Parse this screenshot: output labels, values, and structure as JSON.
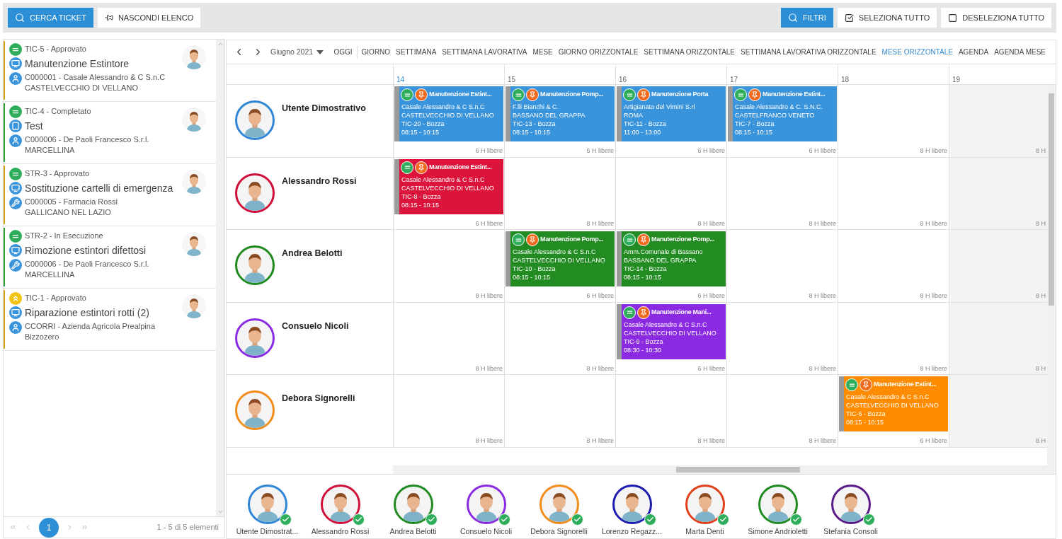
{
  "toolbar": {
    "left_buttons": [
      {
        "label": "CERCA TICKET",
        "kind": "primary"
      },
      {
        "label": "NASCONDI ELENCO",
        "kind": "pin"
      }
    ],
    "right_buttons": [
      {
        "label": "FILTRI",
        "kind": "primary"
      },
      {
        "label": "SELEZIONA TUTTO",
        "kind": "checked"
      },
      {
        "label": "DESELEZIONA TUTTO",
        "kind": "unchecked"
      }
    ]
  },
  "tickets": [
    {
      "status": {
        "kind": "normal",
        "text": "TIC-5 - Approvato"
      },
      "subject": {
        "kind": "monitor",
        "text": "Manutenzione Estintore"
      },
      "customer": {
        "kind": "person",
        "text": "C000001 - Casale Alessandro & C S.n.C",
        "city": "CASTELVECCHIO DI VELLANO"
      },
      "color": "#d4a017"
    },
    {
      "status": {
        "kind": "normal",
        "text": "TIC-4 - Completato"
      },
      "subject": {
        "kind": "tablet",
        "text": "Test"
      },
      "customer": {
        "kind": "person",
        "text": "C000006 - De Paoli Francesco S.r.l.",
        "city": "MARCELLINA"
      },
      "color": "#2e9e2e"
    },
    {
      "status": {
        "kind": "normal",
        "text": "STR-3 - Approvato"
      },
      "subject": {
        "kind": "monitor",
        "text": "Sostituzione cartelli di emergenza"
      },
      "customer": {
        "kind": "wrench",
        "text": "C000005 - Farmacia Rossi",
        "city": "GALLICANO NEL LAZIO"
      },
      "color": "#d4a017"
    },
    {
      "status": {
        "kind": "normal",
        "text": "STR-2 - In Esecuzione"
      },
      "subject": {
        "kind": "monitor",
        "text": "Rimozione estintori difettosi"
      },
      "customer": {
        "kind": "wrench",
        "text": "C000006 - De Paoli Francesco S.r.l.",
        "city": "MARCELLINA"
      },
      "color": "#2e9e2e"
    },
    {
      "status": {
        "kind": "high",
        "text": "TIC-1 - Approvato"
      },
      "subject": {
        "kind": "monitor",
        "text": "Riparazione estintori rotti (2)"
      },
      "customer": {
        "kind": "person",
        "text": "CCORRI - Azienda Agricola Prealpina",
        "city": "Bizzozero"
      },
      "color": "#d4a017"
    }
  ],
  "pager": {
    "pages": [
      {
        "label": "1",
        "selected": true
      }
    ],
    "summary": "1 - 5 di 5 elementi"
  },
  "scheduler": {
    "period": "Giugno 2021",
    "views": [
      {
        "label": "OGGI",
        "selected": false
      },
      {
        "label": "GIORNO",
        "selected": false
      },
      {
        "label": "SETTIMANA",
        "selected": false
      },
      {
        "label": "SETTIMANA LAVORATIVA",
        "selected": false
      },
      {
        "label": "MESE",
        "selected": false
      },
      {
        "label": "GIORNO ORIZZONTALE",
        "selected": false
      },
      {
        "label": "SETTIMANA ORIZZONTALE",
        "selected": false
      },
      {
        "label": "SETTIMANA LAVORATIVA ORIZZONTALE",
        "selected": false
      },
      {
        "label": "MESE ORIZZONTALE",
        "selected": true
      },
      {
        "label": "AGENDA",
        "selected": false
      },
      {
        "label": "AGENDA MESE",
        "selected": false
      }
    ],
    "days": [
      {
        "label": "14",
        "today": true
      },
      {
        "label": "15",
        "today": false
      },
      {
        "label": "16",
        "today": false
      },
      {
        "label": "17",
        "today": false
      },
      {
        "label": "18",
        "today": false
      },
      {
        "label": "19",
        "today": false
      }
    ],
    "rows": [
      {
        "name": "Utente Dimostrativo",
        "color": "#2f86d6",
        "cells": [
          {
            "free": "6 H libere",
            "event": {
              "title": "Manutenzione Estint...",
              "customer": "Casale Alessandro & C S.n.C",
              "city": "CASTELVECCHIO DI VELLANO",
              "ticket": "TIC-20 - Bozza",
              "time": "08:15 - 10:15",
              "color": "#3a94dc"
            }
          },
          {
            "free": "6 H libere",
            "event": {
              "title": "Manutenzione Pomp...",
              "customer": "F.lli Bianchi & C.",
              "city": "BASSANO DEL GRAPPA",
              "ticket": "TIC-13 - Bozza",
              "time": "08:15 - 10:15",
              "color": "#3a94dc"
            }
          },
          {
            "free": "6 H libere",
            "event": {
              "title": "Manutenzione Porta",
              "customer": "Artigianato del Vimini S.rl",
              "city": "ROMA",
              "ticket": "TIC-11 - Bozza",
              "time": "11:00 - 13:00",
              "color": "#3a94dc"
            }
          },
          {
            "free": "6 H libere",
            "event": {
              "title": "Manutenzione Estint...",
              "customer": "Casale Alessandro & C. S.N.C.",
              "city": "CASTELFRANCO VENETO",
              "ticket": "TIC-7 - Bozza",
              "time": "08:15 - 10:15",
              "color": "#3a94dc"
            }
          },
          {
            "free": "8 H libere"
          },
          {
            "free": "8 H"
          }
        ]
      },
      {
        "name": "Alessandro Rossi",
        "color": "#d0103a",
        "cells": [
          {
            "free": "6 H libere",
            "event": {
              "title": "Manutenzione Estint...",
              "customer": "Casale Alessandro & C S.n.C",
              "city": "CASTELVECCHIO DI VELLANO",
              "ticket": "TIC-8 - Bozza",
              "time": "08:15 - 10:15",
              "color": "#dc143c"
            }
          },
          {
            "free": "8 H libere"
          },
          {
            "free": "8 H libere"
          },
          {
            "free": "8 H libere"
          },
          {
            "free": "8 H libere"
          },
          {
            "free": "8 H"
          }
        ]
      },
      {
        "name": "Andrea Belotti",
        "color": "#1f8a1f",
        "cells": [
          {
            "free": "8 H libere"
          },
          {
            "free": "6 H libere",
            "event": {
              "title": "Manutenzione Pomp...",
              "customer": "Casale Alessandro & C S.n.C",
              "city": "CASTELVECCHIO DI VELLANO",
              "ticket": "TIC-10 - Bozza",
              "time": "08:15 - 10:15",
              "color": "#228b22"
            }
          },
          {
            "free": "6 H libere",
            "event": {
              "title": "Manutenzione Pomp...",
              "customer": "Amm.Comunale di Bassano",
              "city": "BASSANO DEL GRAPPA",
              "ticket": "TIC-14 - Bozza",
              "time": "08:15 - 10:15",
              "color": "#228b22"
            }
          },
          {
            "free": "8 H libere"
          },
          {
            "free": "8 H libere"
          },
          {
            "free": "8 H"
          }
        ]
      },
      {
        "name": "Consuelo Nicoli",
        "color": "#8a2be2",
        "cells": [
          {
            "free": "8 H libere"
          },
          {
            "free": "8 H libere"
          },
          {
            "free": "6 H libere",
            "event": {
              "title": "Manutenzione Mani...",
              "customer": "Casale Alessandro & C S.n.C",
              "city": "CASTELVECCHIO DI VELLANO",
              "ticket": "TIC-9 - Bozza",
              "time": "08:30 - 10:30",
              "color": "#8a2be2"
            }
          },
          {
            "free": "8 H libere"
          },
          {
            "free": "8 H libere"
          },
          {
            "free": "8 H"
          }
        ]
      },
      {
        "name": "Debora Signorelli",
        "color": "#f28c1b",
        "cells": [
          {
            "free": "8 H libere"
          },
          {
            "free": "8 H libere"
          },
          {
            "free": "8 H libere"
          },
          {
            "free": "8 H libere"
          },
          {
            "free": "6 H libere",
            "event": {
              "title": "Manutenzione Estint...",
              "customer": "Casale Alessandro & C S.n.C",
              "city": "CASTELVECCHIO DI VELLANO",
              "ticket": "TIC-6 - Bozza",
              "time": "08:15 - 10:15",
              "color": "#ff8c00"
            }
          },
          {
            "free": "8 H"
          }
        ]
      }
    ]
  },
  "resources": [
    {
      "name": "Utente Dimostrat...",
      "color": "#2f86d6",
      "checked": true
    },
    {
      "name": "Alessandro Rossi",
      "color": "#d0103a",
      "checked": true
    },
    {
      "name": "Andrea Belotti",
      "color": "#1f8a1f",
      "checked": true
    },
    {
      "name": "Consuelo Nicoli",
      "color": "#8a2be2",
      "checked": true
    },
    {
      "name": "Debora Signorelli",
      "color": "#f28c1b",
      "checked": true
    },
    {
      "name": "Lorenzo Regazz...",
      "color": "#1c1cb0",
      "checked": true
    },
    {
      "name": "Marta Denti",
      "color": "#e0401a",
      "checked": true
    },
    {
      "name": "Simone Andrioletti",
      "color": "#1f8a1f",
      "checked": true
    },
    {
      "name": "Stefania Consoli",
      "color": "#5b1a8a",
      "checked": true
    }
  ]
}
